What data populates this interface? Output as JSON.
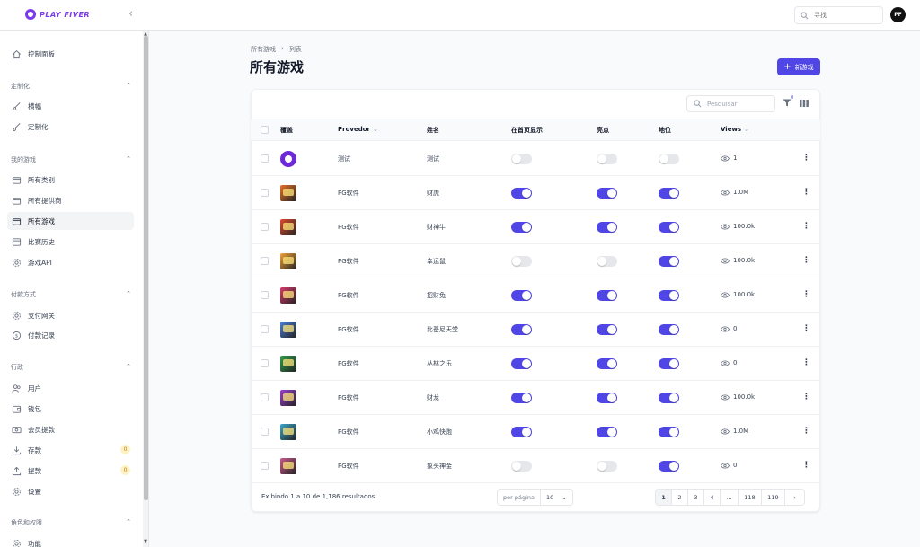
{
  "brand": {
    "name": "PLAY FIVER",
    "accent": "#4f46e5",
    "logo_color": "#7c3aed"
  },
  "topbar": {
    "search_placeholder": "寻找",
    "avatar_initials": "PF"
  },
  "sidebar": {
    "dashboard": "控制面板",
    "groups": [
      {
        "label": "定制化",
        "items": [
          "横幅",
          "定制化"
        ]
      },
      {
        "label": "我的游戏",
        "items": [
          "所有类别",
          "所有提供商",
          "所有游戏",
          "比赛历史",
          "游戏API"
        ]
      },
      {
        "label": "付款方式",
        "items": [
          "支付网关",
          "付款记录"
        ]
      },
      {
        "label": "行政",
        "items": [
          "用户",
          "钱包",
          "会员提款",
          "存款",
          "提款",
          "设置"
        ]
      },
      {
        "label": "角色和权限",
        "items": [
          "功能"
        ]
      }
    ],
    "active_item": "所有游戏",
    "badges": {
      "deposits": "0",
      "withdrawals": "0"
    }
  },
  "breadcrumb": [
    "所有游戏",
    "列表"
  ],
  "page_title": "所有游戏",
  "new_button": "新游戏",
  "table": {
    "search_placeholder": "Pesquisar",
    "filter_count": "0",
    "columns": [
      "覆盖",
      "Provedor",
      "姓名",
      "在首页显示",
      "亮点",
      "地位",
      "Views"
    ],
    "rows": [
      {
        "provider": "测试",
        "name": "测试",
        "home": false,
        "highlight": false,
        "status": false,
        "views": "1",
        "thumb": "logo"
      },
      {
        "provider": "PG软件",
        "name": "财虎",
        "home": true,
        "highlight": true,
        "status": true,
        "views": "1.0M",
        "thumb": "#e8742a"
      },
      {
        "provider": "PG软件",
        "name": "财神牛",
        "home": true,
        "highlight": true,
        "status": true,
        "views": "100.0k",
        "thumb": "#e04b2e"
      },
      {
        "provider": "PG软件",
        "name": "幸运鼠",
        "home": false,
        "highlight": false,
        "status": true,
        "views": "100.0k",
        "thumb": "#f2a33a"
      },
      {
        "provider": "PG软件",
        "name": "招财兔",
        "home": true,
        "highlight": true,
        "status": true,
        "views": "100.0k",
        "thumb": "#d93b6a"
      },
      {
        "provider": "PG软件",
        "name": "比基尼天堂",
        "home": true,
        "highlight": true,
        "status": true,
        "views": "0",
        "thumb": "#4c7fd9"
      },
      {
        "provider": "PG软件",
        "name": "丛林之乐",
        "home": true,
        "highlight": true,
        "status": true,
        "views": "0",
        "thumb": "#2f9e4f"
      },
      {
        "provider": "PG软件",
        "name": "财龙",
        "home": true,
        "highlight": true,
        "status": true,
        "views": "100.0k",
        "thumb": "#9b3fd1"
      },
      {
        "provider": "PG软件",
        "name": "小鸡快跑",
        "home": true,
        "highlight": true,
        "status": true,
        "views": "1.0M",
        "thumb": "#3aa6c9"
      },
      {
        "provider": "PG软件",
        "name": "象头神金",
        "home": false,
        "highlight": false,
        "status": true,
        "views": "0",
        "thumb": "#c95a8a"
      }
    ]
  },
  "footer": {
    "summary": "Exibindo 1 a 10 de 1,186 resultados",
    "per_page_label": "por página",
    "per_page_value": "10",
    "pages": [
      "1",
      "2",
      "3",
      "4",
      "...",
      "118",
      "119",
      "›"
    ]
  }
}
